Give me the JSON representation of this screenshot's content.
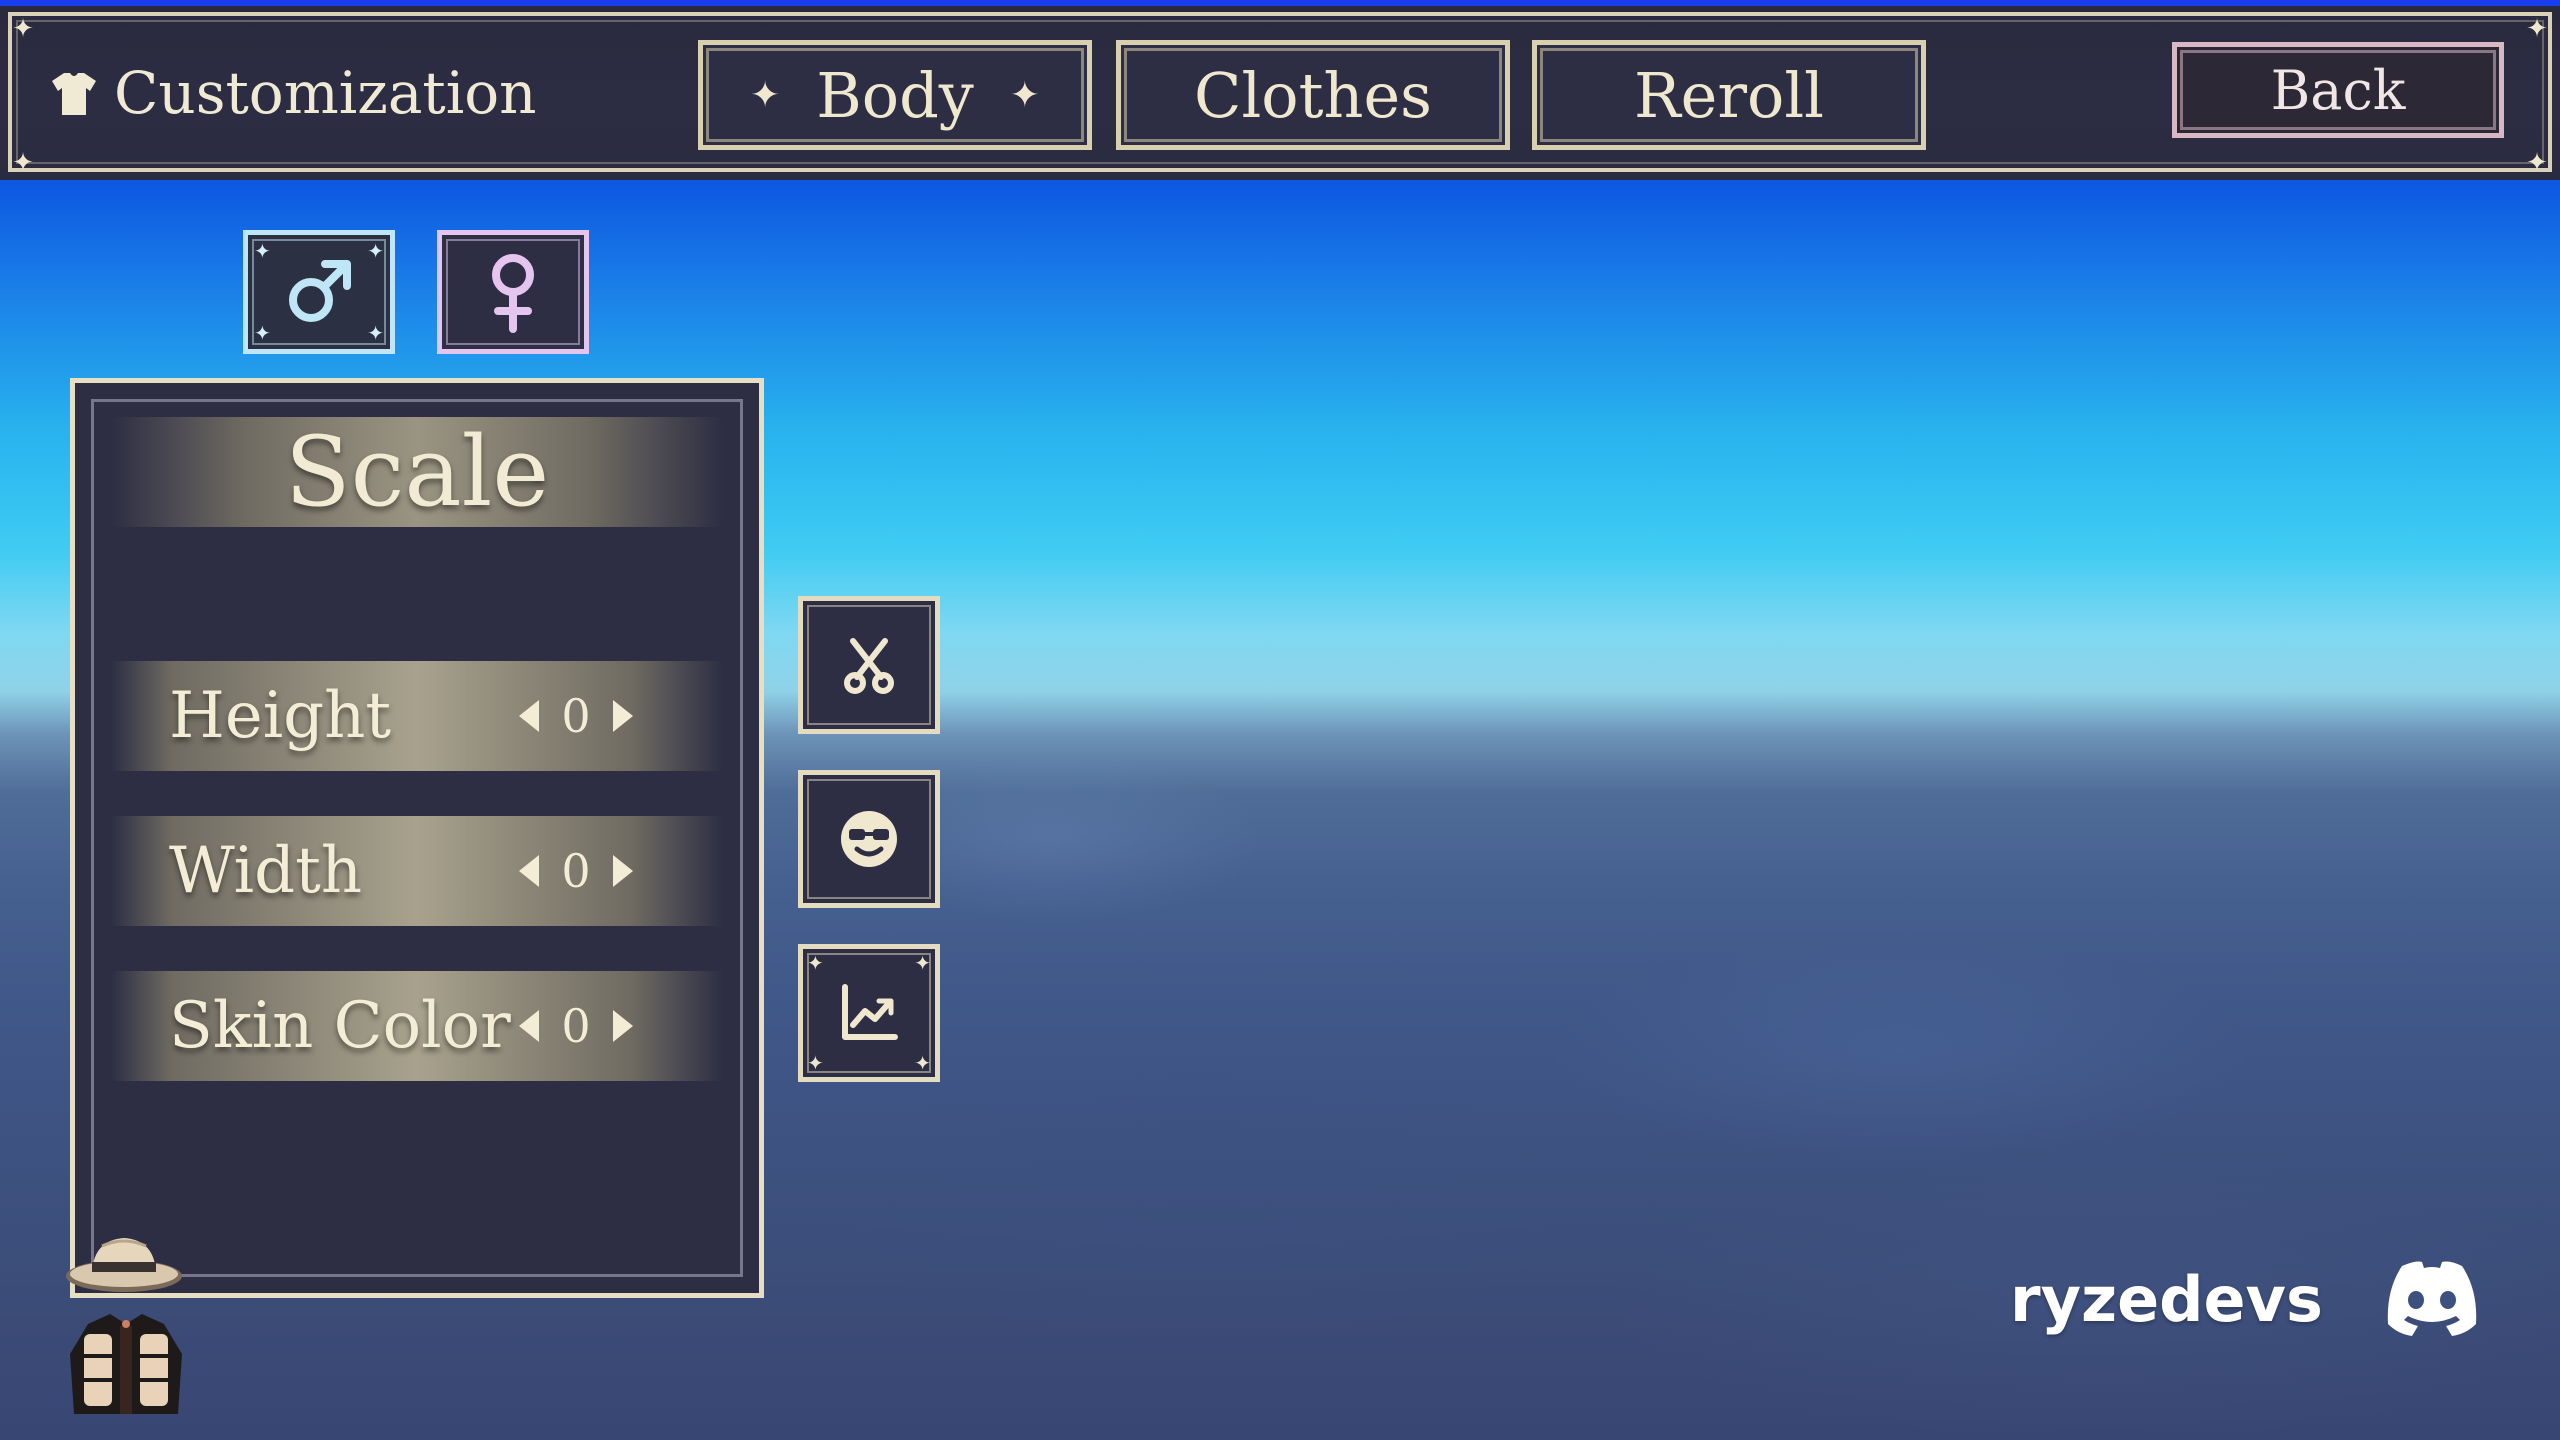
{
  "header": {
    "title": "Customization",
    "tabs": [
      {
        "label": "Body",
        "active": true
      },
      {
        "label": "Clothes",
        "active": false
      },
      {
        "label": "Reroll",
        "active": false
      }
    ],
    "back_label": "Back"
  },
  "gender": {
    "options": [
      {
        "name": "male",
        "icon": "male-symbol-icon",
        "color": "#bfe6f6",
        "selected": true
      },
      {
        "name": "female",
        "icon": "female-symbol-icon",
        "color": "#e6c4f0",
        "selected": false
      }
    ]
  },
  "panel": {
    "title": "Scale",
    "rows": [
      {
        "label": "Height",
        "value": "0"
      },
      {
        "label": "Width",
        "value": "0"
      },
      {
        "label": "Skin Color",
        "value": "0"
      }
    ]
  },
  "side_buttons": [
    {
      "icon": "scissors-icon"
    },
    {
      "icon": "face-glasses-icon"
    },
    {
      "icon": "chart-icon"
    }
  ],
  "quick_items": [
    {
      "icon": "hat-icon"
    },
    {
      "icon": "jacket-icon"
    }
  ],
  "watermark": {
    "text": "ryzedevs",
    "icon": "discord-icon"
  },
  "colors": {
    "accent": "#d8d0ae",
    "panel_bg": "#2d2e43",
    "text": "#f0ead4"
  }
}
